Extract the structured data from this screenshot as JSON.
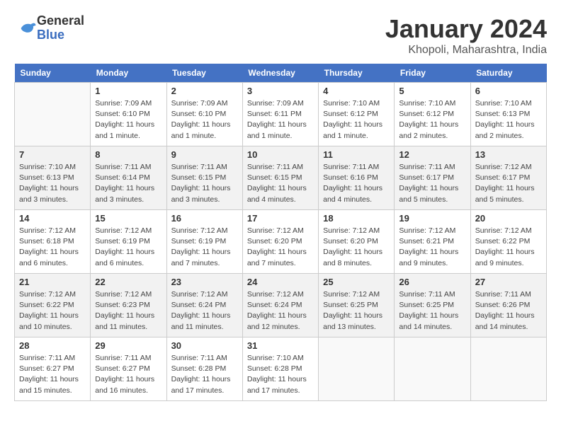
{
  "header": {
    "logo_general": "General",
    "logo_blue": "Blue",
    "month_title": "January 2024",
    "location": "Khopoli, Maharashtra, India"
  },
  "calendar": {
    "days_of_week": [
      "Sunday",
      "Monday",
      "Tuesday",
      "Wednesday",
      "Thursday",
      "Friday",
      "Saturday"
    ],
    "weeks": [
      [
        {
          "day": "",
          "info": ""
        },
        {
          "day": "1",
          "info": "Sunrise: 7:09 AM\nSunset: 6:10 PM\nDaylight: 11 hours and 1 minute."
        },
        {
          "day": "2",
          "info": "Sunrise: 7:09 AM\nSunset: 6:10 PM\nDaylight: 11 hours and 1 minute."
        },
        {
          "day": "3",
          "info": "Sunrise: 7:09 AM\nSunset: 6:11 PM\nDaylight: 11 hours and 1 minute."
        },
        {
          "day": "4",
          "info": "Sunrise: 7:10 AM\nSunset: 6:12 PM\nDaylight: 11 hours and 1 minute."
        },
        {
          "day": "5",
          "info": "Sunrise: 7:10 AM\nSunset: 6:12 PM\nDaylight: 11 hours and 2 minutes."
        },
        {
          "day": "6",
          "info": "Sunrise: 7:10 AM\nSunset: 6:13 PM\nDaylight: 11 hours and 2 minutes."
        }
      ],
      [
        {
          "day": "7",
          "info": "Sunrise: 7:10 AM\nSunset: 6:13 PM\nDaylight: 11 hours and 3 minutes."
        },
        {
          "day": "8",
          "info": "Sunrise: 7:11 AM\nSunset: 6:14 PM\nDaylight: 11 hours and 3 minutes."
        },
        {
          "day": "9",
          "info": "Sunrise: 7:11 AM\nSunset: 6:15 PM\nDaylight: 11 hours and 3 minutes."
        },
        {
          "day": "10",
          "info": "Sunrise: 7:11 AM\nSunset: 6:15 PM\nDaylight: 11 hours and 4 minutes."
        },
        {
          "day": "11",
          "info": "Sunrise: 7:11 AM\nSunset: 6:16 PM\nDaylight: 11 hours and 4 minutes."
        },
        {
          "day": "12",
          "info": "Sunrise: 7:11 AM\nSunset: 6:17 PM\nDaylight: 11 hours and 5 minutes."
        },
        {
          "day": "13",
          "info": "Sunrise: 7:12 AM\nSunset: 6:17 PM\nDaylight: 11 hours and 5 minutes."
        }
      ],
      [
        {
          "day": "14",
          "info": "Sunrise: 7:12 AM\nSunset: 6:18 PM\nDaylight: 11 hours and 6 minutes."
        },
        {
          "day": "15",
          "info": "Sunrise: 7:12 AM\nSunset: 6:19 PM\nDaylight: 11 hours and 6 minutes."
        },
        {
          "day": "16",
          "info": "Sunrise: 7:12 AM\nSunset: 6:19 PM\nDaylight: 11 hours and 7 minutes."
        },
        {
          "day": "17",
          "info": "Sunrise: 7:12 AM\nSunset: 6:20 PM\nDaylight: 11 hours and 7 minutes."
        },
        {
          "day": "18",
          "info": "Sunrise: 7:12 AM\nSunset: 6:20 PM\nDaylight: 11 hours and 8 minutes."
        },
        {
          "day": "19",
          "info": "Sunrise: 7:12 AM\nSunset: 6:21 PM\nDaylight: 11 hours and 9 minutes."
        },
        {
          "day": "20",
          "info": "Sunrise: 7:12 AM\nSunset: 6:22 PM\nDaylight: 11 hours and 9 minutes."
        }
      ],
      [
        {
          "day": "21",
          "info": "Sunrise: 7:12 AM\nSunset: 6:22 PM\nDaylight: 11 hours and 10 minutes."
        },
        {
          "day": "22",
          "info": "Sunrise: 7:12 AM\nSunset: 6:23 PM\nDaylight: 11 hours and 11 minutes."
        },
        {
          "day": "23",
          "info": "Sunrise: 7:12 AM\nSunset: 6:24 PM\nDaylight: 11 hours and 11 minutes."
        },
        {
          "day": "24",
          "info": "Sunrise: 7:12 AM\nSunset: 6:24 PM\nDaylight: 11 hours and 12 minutes."
        },
        {
          "day": "25",
          "info": "Sunrise: 7:12 AM\nSunset: 6:25 PM\nDaylight: 11 hours and 13 minutes."
        },
        {
          "day": "26",
          "info": "Sunrise: 7:11 AM\nSunset: 6:25 PM\nDaylight: 11 hours and 14 minutes."
        },
        {
          "day": "27",
          "info": "Sunrise: 7:11 AM\nSunset: 6:26 PM\nDaylight: 11 hours and 14 minutes."
        }
      ],
      [
        {
          "day": "28",
          "info": "Sunrise: 7:11 AM\nSunset: 6:27 PM\nDaylight: 11 hours and 15 minutes."
        },
        {
          "day": "29",
          "info": "Sunrise: 7:11 AM\nSunset: 6:27 PM\nDaylight: 11 hours and 16 minutes."
        },
        {
          "day": "30",
          "info": "Sunrise: 7:11 AM\nSunset: 6:28 PM\nDaylight: 11 hours and 17 minutes."
        },
        {
          "day": "31",
          "info": "Sunrise: 7:10 AM\nSunset: 6:28 PM\nDaylight: 11 hours and 17 minutes."
        },
        {
          "day": "",
          "info": ""
        },
        {
          "day": "",
          "info": ""
        },
        {
          "day": "",
          "info": ""
        }
      ]
    ]
  }
}
